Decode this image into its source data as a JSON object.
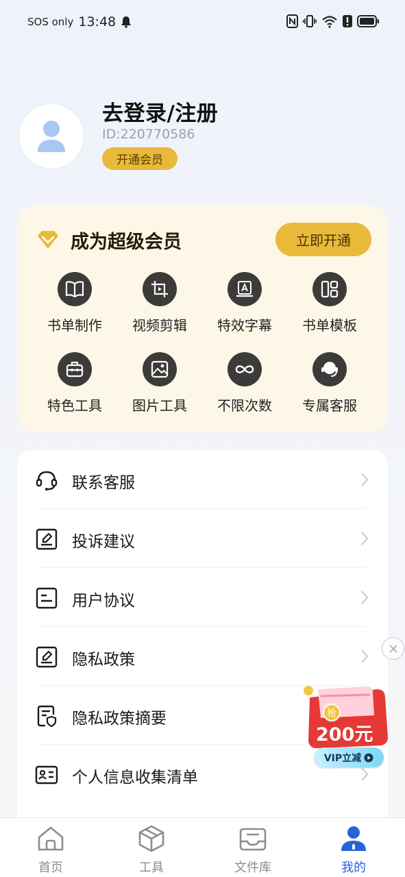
{
  "status_bar": {
    "carrier": "SOS only",
    "time": "13:48"
  },
  "profile": {
    "title": "去登录/注册",
    "user_id": "ID:220770586",
    "member_button": "开通会员"
  },
  "vip_card": {
    "title": "成为超级会员",
    "activate_button": "立即开通",
    "features": [
      {
        "label": "书单制作",
        "icon": "book-icon"
      },
      {
        "label": "视频剪辑",
        "icon": "crop-video-icon"
      },
      {
        "label": "特效字幕",
        "icon": "subtitle-icon"
      },
      {
        "label": "书单模板",
        "icon": "template-icon"
      },
      {
        "label": "特色工具",
        "icon": "toolbox-icon"
      },
      {
        "label": "图片工具",
        "icon": "image-icon"
      },
      {
        "label": "不限次数",
        "icon": "infinity-icon"
      },
      {
        "label": "专属客服",
        "icon": "agent-icon"
      }
    ]
  },
  "menu": [
    {
      "label": "联系客服",
      "icon": "headset-icon"
    },
    {
      "label": "投诉建议",
      "icon": "edit-icon"
    },
    {
      "label": "用户协议",
      "icon": "document-icon"
    },
    {
      "label": "隐私政策",
      "icon": "edit-icon"
    },
    {
      "label": "隐私政策摘要",
      "icon": "shield-document-icon"
    },
    {
      "label": "个人信息收集清单",
      "icon": "id-card-icon"
    }
  ],
  "promo": {
    "amount": "200元",
    "vip_label": "VIP立减",
    "badge": "抢"
  },
  "bottom_nav": [
    {
      "label": "首页",
      "icon": "home-icon"
    },
    {
      "label": "工具",
      "icon": "cube-icon"
    },
    {
      "label": "文件库",
      "icon": "inbox-icon"
    },
    {
      "label": "我的",
      "icon": "user-icon"
    }
  ],
  "colors": {
    "accent_gold": "#e8b93a",
    "vip_card_bg": "#fdf7e7",
    "active_nav": "#2a63d8",
    "feature_icon_bg": "#3d3b3a"
  }
}
